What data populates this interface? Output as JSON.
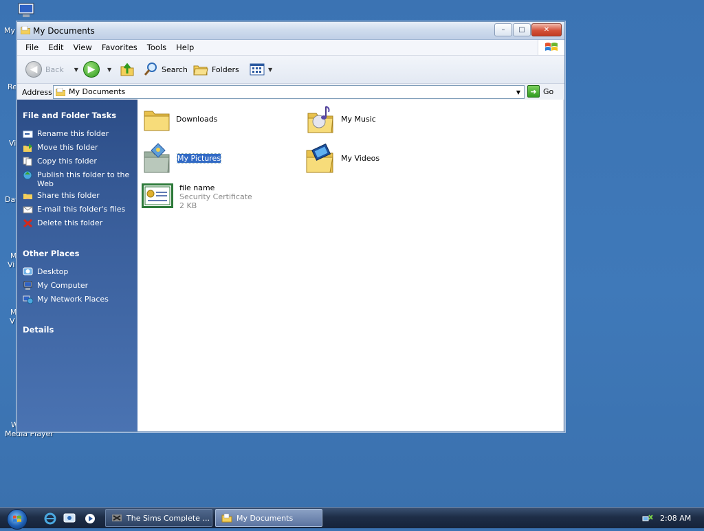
{
  "desktop": {
    "icon_labels": [
      "My",
      "Re",
      "Vi",
      "Dat",
      "M\nVi",
      "M\nV",
      "W\nMedia Player"
    ],
    "media_player_label": "Media Player"
  },
  "window": {
    "title": "My Documents",
    "caption": {
      "minimize": "–",
      "maximize": "□",
      "close": "✕"
    }
  },
  "menu": [
    "File",
    "Edit",
    "View",
    "Favorites",
    "Tools",
    "Help"
  ],
  "toolbar": {
    "back_label": "Back",
    "search_label": "Search",
    "folders_label": "Folders"
  },
  "address": {
    "label": "Address",
    "value": "My Documents",
    "go_label": "Go"
  },
  "tasks": {
    "file_folder_heading": "File and Folder Tasks",
    "items": [
      {
        "label": "Rename this folder",
        "icon": "rename-icon"
      },
      {
        "label": "Move this folder",
        "icon": "move-icon"
      },
      {
        "label": "Copy this folder",
        "icon": "copy-icon"
      },
      {
        "label": "Publish this folder to the Web",
        "icon": "publish-web-icon"
      },
      {
        "label": "Share this folder",
        "icon": "share-icon"
      },
      {
        "label": "E-mail this folder's files",
        "icon": "email-icon"
      },
      {
        "label": "Delete this folder",
        "icon": "delete-icon"
      }
    ],
    "other_places_heading": "Other Places",
    "places": [
      {
        "label": "Desktop",
        "icon": "desktop-icon"
      },
      {
        "label": "My Computer",
        "icon": "my-computer-icon"
      },
      {
        "label": "My Network Places",
        "icon": "network-places-icon"
      }
    ],
    "details_heading": "Details"
  },
  "files": [
    {
      "name": "Downloads",
      "icon": "folder-icon"
    },
    {
      "name": "My Music",
      "icon": "music-folder-icon"
    },
    {
      "name": "My Pictures",
      "icon": "pictures-folder-icon",
      "selected": true
    },
    {
      "name": "My Videos",
      "icon": "videos-folder-icon"
    },
    {
      "name": "file name",
      "type": "Security Certificate",
      "size": "2 KB",
      "icon": "certificate-icon"
    }
  ],
  "taskbar": {
    "tasks": [
      {
        "label": "The Sims Complete ...",
        "icon": "sims-icon",
        "active": false
      },
      {
        "label": "My Documents",
        "icon": "folder-icon",
        "active": true
      }
    ],
    "clock": "2:08 AM"
  },
  "colors": {
    "desktop": "#3b73b3",
    "taskpane": "#2c4d87",
    "selection": "#316ac5",
    "close_button": "#d3523a"
  }
}
